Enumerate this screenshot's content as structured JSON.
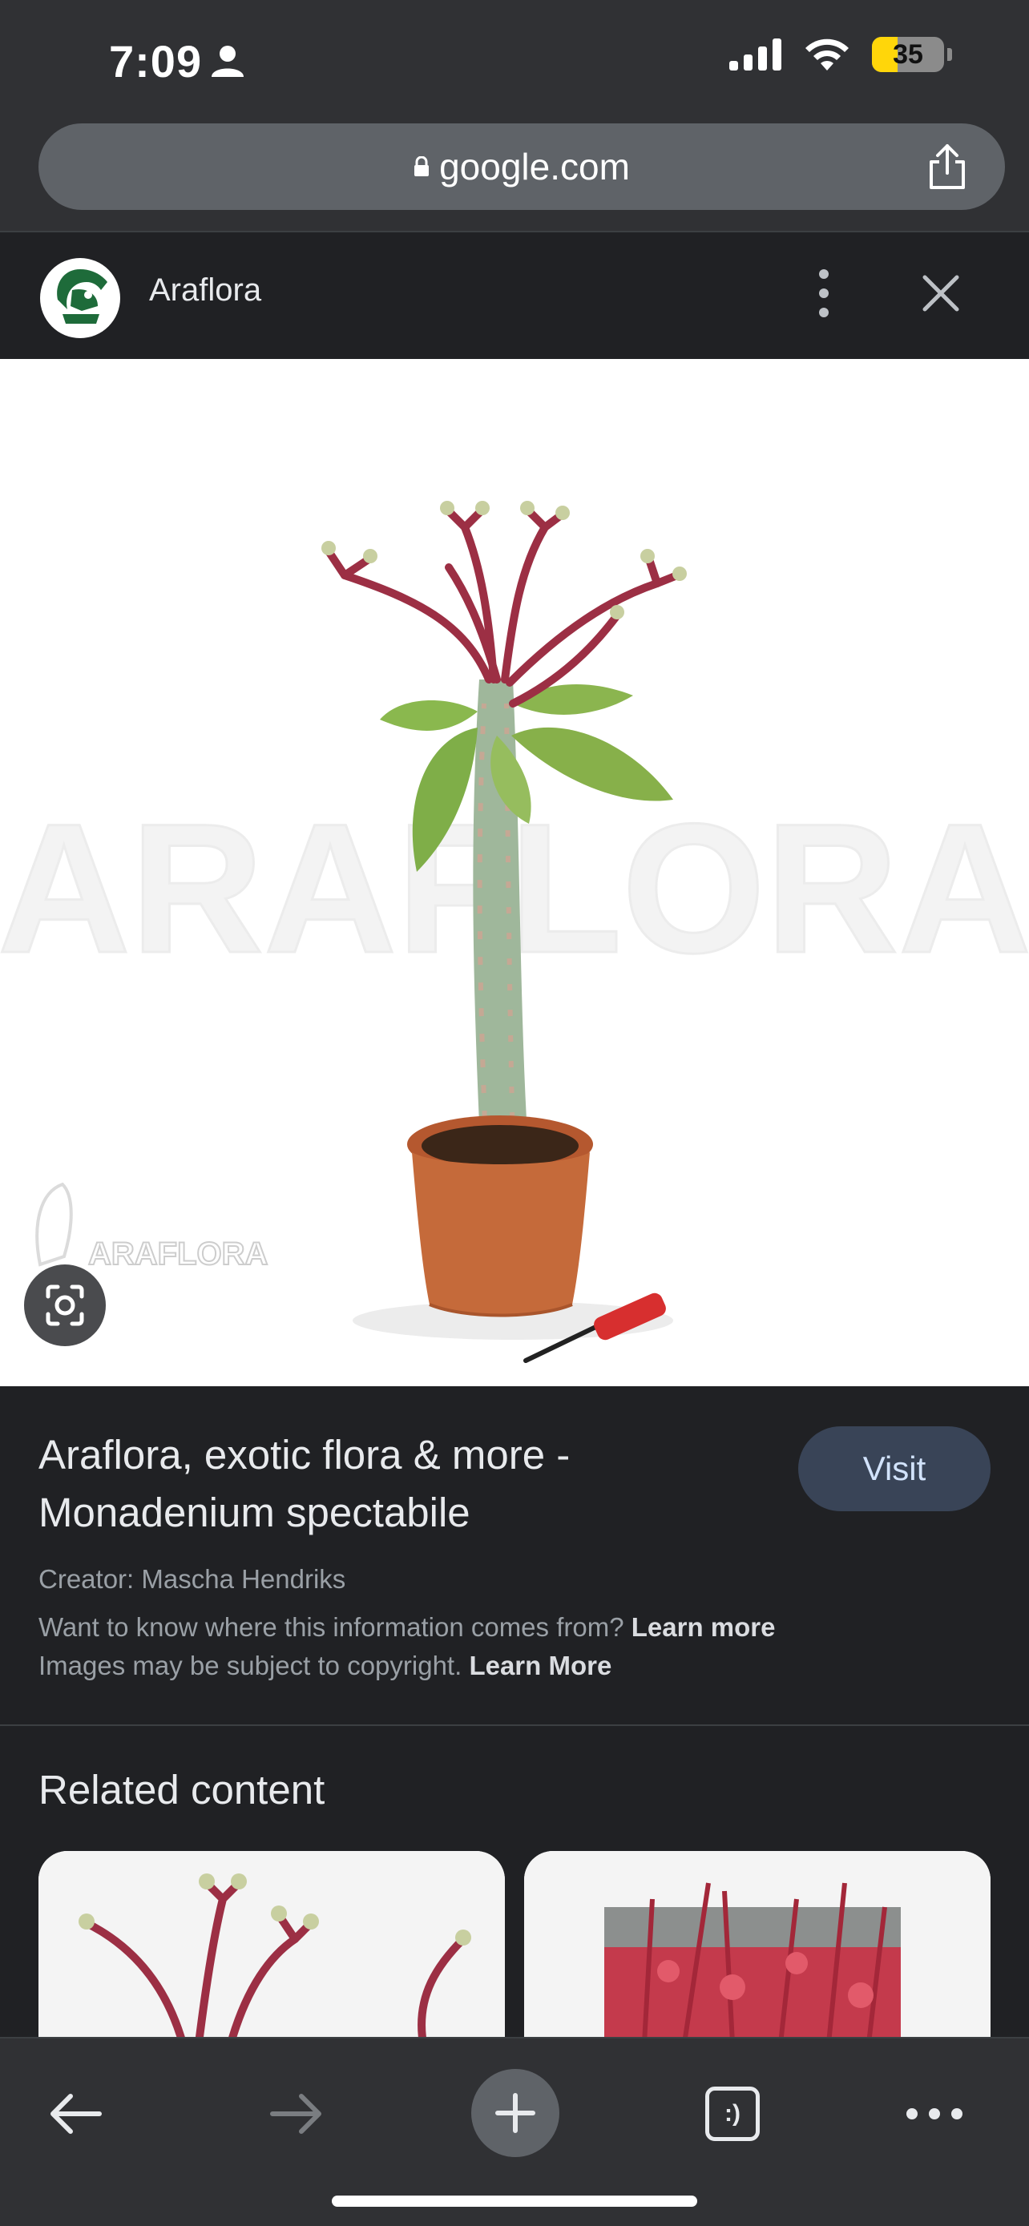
{
  "status_bar": {
    "time": "7:09",
    "battery_level": "35",
    "battery_fraction": 0.35,
    "icons": [
      "person-icon",
      "cellular-signal-icon",
      "wifi-icon",
      "battery-icon"
    ]
  },
  "address_bar": {
    "url": "google.com",
    "icons": [
      "lock-icon",
      "share-icon"
    ]
  },
  "source": {
    "name": "Araflora",
    "icons": [
      "parrot-logo-icon",
      "more-vert-icon",
      "close-icon"
    ]
  },
  "image": {
    "watermark": "ARAFLORA",
    "corner_logo_text": "ARAFLORA",
    "icons": [
      "google-lens-icon"
    ]
  },
  "info": {
    "title": "Araflora, exotic flora & more - Monadenium spectabile",
    "visit_label": "Visit",
    "creator": "Creator: Mascha Hendriks",
    "info_source_text": "Want to know where this information comes from?",
    "info_source_link": "Learn more",
    "copyright_text": "Images may be subject to copyright.",
    "copyright_link": "Learn More"
  },
  "related": {
    "title": "Related content"
  },
  "toolbar": {
    "tab_count_label": ":)",
    "icons": [
      "back-arrow-icon",
      "forward-arrow-icon",
      "plus-icon",
      "tab-switcher-icon",
      "more-horiz-icon"
    ]
  },
  "colors": {
    "toolbar_bg": "#303134",
    "page_bg": "#202124",
    "visit_button": "#394457",
    "battery": "#ffd60a"
  }
}
